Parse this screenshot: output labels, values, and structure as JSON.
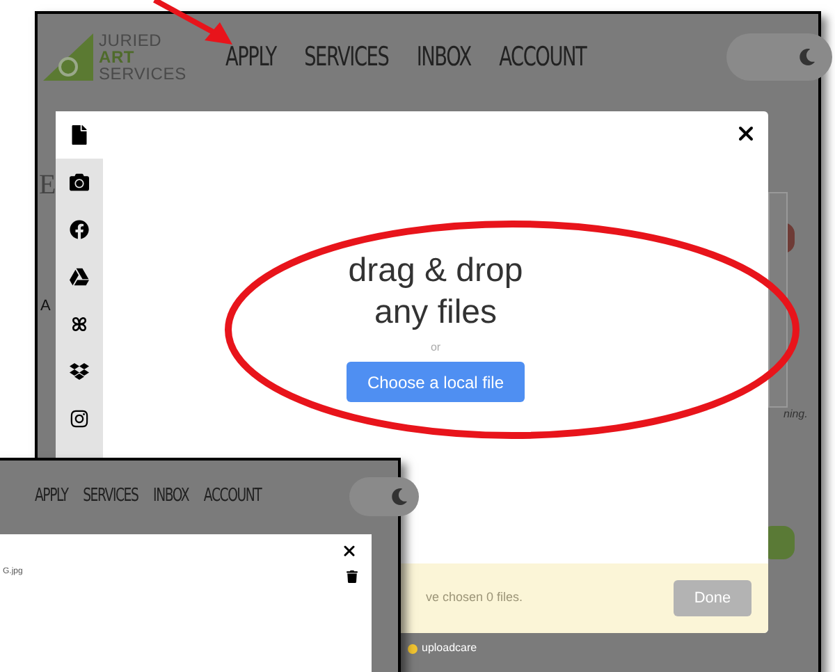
{
  "main_screen": {
    "logo": [
      "JURIED",
      "ART",
      "SERVICES"
    ],
    "nav": [
      "APPLY",
      "SERVICES",
      "INBOX",
      "ACCOUNT"
    ],
    "dark_mode": true,
    "background_texts": [
      "E",
      "A",
      "ning."
    ],
    "upload_dialog": {
      "sources": [
        {
          "kind": "file",
          "selected": true
        },
        {
          "kind": "camera",
          "selected": false
        },
        {
          "kind": "facebook",
          "selected": false
        },
        {
          "kind": "drive",
          "selected": false
        },
        {
          "kind": "photos",
          "selected": false
        },
        {
          "kind": "dropbox",
          "selected": false
        },
        {
          "kind": "instagram",
          "selected": false
        }
      ],
      "title": "drag & drop",
      "subtitle": "any files",
      "or": "or",
      "choose_button": "Choose a local file",
      "status": "ve chosen 0 files.",
      "done_button": {
        "label": "Done",
        "disabled": true
      },
      "powered_by": "uploadcare"
    }
  },
  "inset_screen": {
    "nav": [
      "APPLY",
      "SERVICES",
      "INBOX",
      "ACCOUNT"
    ],
    "dark_mode": true,
    "file_name": "G.jpg"
  }
}
